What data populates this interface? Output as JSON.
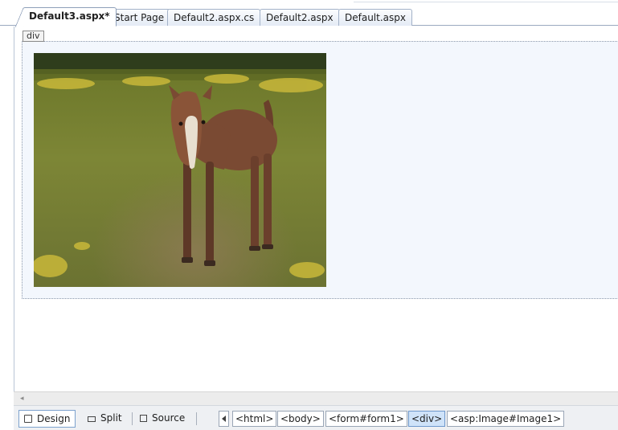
{
  "editor": {
    "tabs": [
      {
        "label": "Default3.aspx*",
        "active": true
      },
      {
        "label": "Start Page",
        "active": false
      },
      {
        "label": "Default2.aspx.cs",
        "active": false
      },
      {
        "label": "Default2.aspx",
        "active": false
      },
      {
        "label": "Default.aspx",
        "active": false
      }
    ]
  },
  "design_surface": {
    "element_tag": "div",
    "image": {
      "subject": "photo of a brown foal standing in a grassy field"
    }
  },
  "scrollbar": {
    "left_arrow": "◂"
  },
  "view_bar": {
    "modes": [
      {
        "label": "Design",
        "icon": "design-view-icon",
        "active": true
      },
      {
        "label": "Split",
        "icon": "split-view-icon",
        "active": false
      },
      {
        "label": "Source",
        "icon": "source-view-icon",
        "active": false
      }
    ],
    "breadcrumbs": [
      {
        "label": "<html>",
        "active": false
      },
      {
        "label": "<body>",
        "active": false
      },
      {
        "label": "<form#form1>",
        "active": false
      },
      {
        "label": "<div>",
        "active": true
      },
      {
        "label": "<asp:Image#Image1>",
        "active": false
      }
    ]
  },
  "colors": {
    "tab_border": "#8e9fb9",
    "div_background": "#f3f7fd",
    "active_crumb": "#cfe3f9"
  }
}
